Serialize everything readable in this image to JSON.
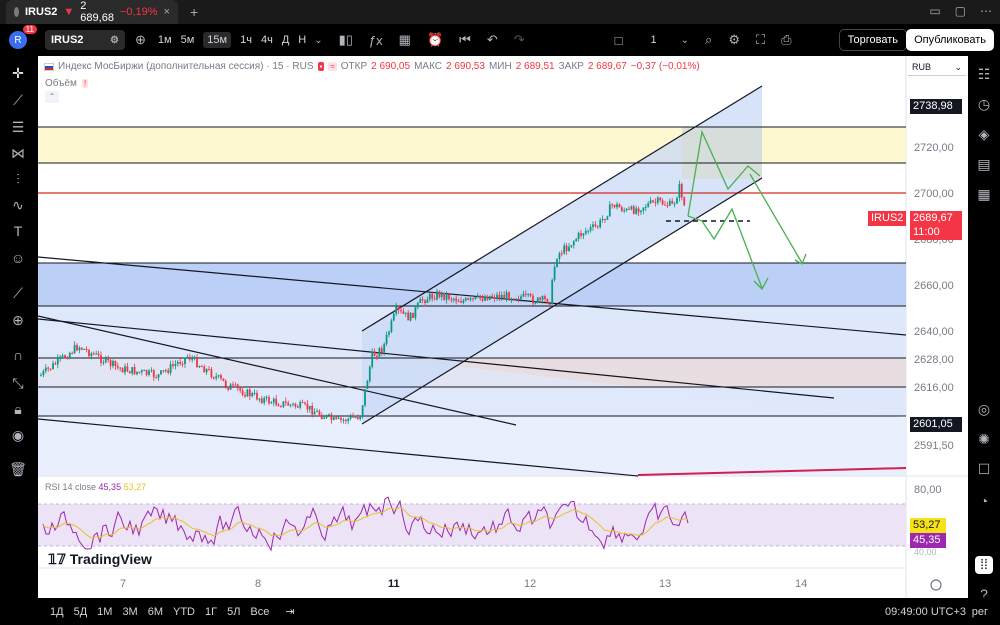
{
  "tab": {
    "symbol": "IRUS2",
    "arrow": "▼",
    "price": "2 689,68",
    "change": "−0,19%",
    "close": "×"
  },
  "tabbar": {
    "plus": "+",
    "icon_a": "▭",
    "icon_b": "▢",
    "icon_c": "⋯"
  },
  "header": {
    "avatar": "R",
    "badge": "11",
    "symbol": "IRUS2",
    "timeframes": [
      "1м",
      "5м",
      "15м",
      "1ч",
      "4ч",
      "Д",
      "Н"
    ],
    "active_timeframe": "15м",
    "layout_count": "1",
    "trade_button": "Торговать",
    "publish_button": "Опубликовать"
  },
  "legend": {
    "title": "Индекс МосБиржи (дополнительная сессия) · 15 · RUS",
    "open_label": "ОТКР",
    "open": "2 690,05",
    "high_label": "МАКС",
    "high": "2 690,53",
    "low_label": "МИН",
    "low": "2 689,51",
    "close_label": "ЗАКР",
    "close": "2 689,67",
    "change": "−0,37 (−0,01%)",
    "volume_label": "Объём"
  },
  "scale": {
    "currency": "RUB"
  },
  "price_axis": [
    "2720,00",
    "2700,00",
    "2680,00",
    "2660,00",
    "2640,00",
    "2628,00",
    "2616,00",
    "2591,50"
  ],
  "price_labels": {
    "top_level": "2738,98",
    "symbol_tag": "IRUS2",
    "current": "2689,67",
    "countdown": "11:00",
    "bottom_level": "2601,05"
  },
  "rsi": {
    "label": "RSI 14 close",
    "rsi_value": "45,35",
    "ma_value": "53,27",
    "axis_top": "80,00",
    "axis_bottom": "40,00"
  },
  "logo": "TradingView",
  "date_axis": [
    {
      "label": "7",
      "bold": false
    },
    {
      "label": "8",
      "bold": false
    },
    {
      "label": "11",
      "bold": true
    },
    {
      "label": "12",
      "bold": false
    },
    {
      "label": "13",
      "bold": false
    },
    {
      "label": "14",
      "bold": false
    }
  ],
  "bottom": {
    "ranges": [
      "1Д",
      "5Д",
      "1М",
      "3М",
      "6М",
      "YTD",
      "1Г",
      "5Л",
      "Все"
    ],
    "time": "09:49:00 UTC+3",
    "adjust": "рег"
  },
  "colors": {
    "up": "#089981",
    "down": "#f23645",
    "accent": "#2962ff"
  }
}
